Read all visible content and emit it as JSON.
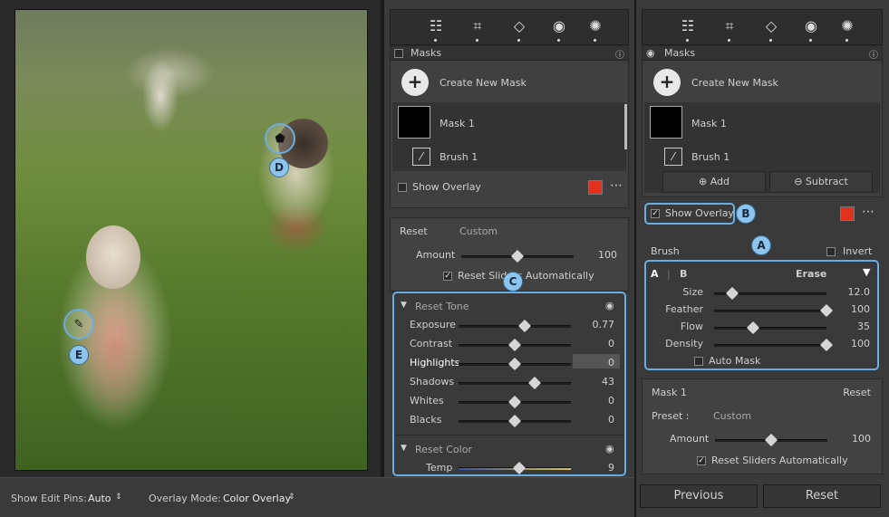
{
  "bottom_bar": {
    "edit_pins_label": "Show Edit Pins:",
    "edit_pins_value": "Auto",
    "overlay_mode_label": "Overlay Mode:",
    "overlay_mode_value": "Color Overlay"
  },
  "photo_markers": {
    "d": "D",
    "e": "E"
  },
  "left_panel": {
    "masks_title": "Masks",
    "create_mask": "Create New Mask",
    "mask_name": "Mask 1",
    "brush_name": "Brush 1",
    "show_overlay": "Show Overlay",
    "reset_label": "Reset",
    "preset_value": "Custom",
    "amount_label": "Amount",
    "amount_value": "100",
    "reset_sliders": "Reset Sliders Automatically",
    "badge_c": "C",
    "tone_title": "Reset Tone",
    "tone": [
      {
        "label": "Exposure",
        "value": "0.77",
        "pos": 0.59
      },
      {
        "label": "Contrast",
        "value": "0",
        "pos": 0.5
      },
      {
        "label": "Highlights",
        "value": "0",
        "pos": 0.5
      },
      {
        "label": "Shadows",
        "value": "43",
        "pos": 0.68
      },
      {
        "label": "Whites",
        "value": "0",
        "pos": 0.5
      },
      {
        "label": "Blacks",
        "value": "0",
        "pos": 0.5
      }
    ],
    "color_title": "Reset Color",
    "temp_label": "Temp",
    "temp_value": "9",
    "temp_pos": 0.54,
    "amount_pos": 0.5
  },
  "right_panel": {
    "masks_title": "Masks",
    "create_mask": "Create New Mask",
    "mask_name": "Mask 1",
    "brush_name": "Brush 1",
    "add": "Add",
    "subtract": "Subtract",
    "show_overlay": "Show Overlay",
    "badge_b": "B",
    "badge_a": "A",
    "brush_title": "Brush",
    "invert": "Invert",
    "tab_a": "A",
    "tab_b": "B",
    "tab_erase": "Erase",
    "brush": [
      {
        "label": "Size",
        "value": "12.0",
        "pos": 0.16
      },
      {
        "label": "Feather",
        "value": "100",
        "pos": 1.0
      },
      {
        "label": "Flow",
        "value": "35",
        "pos": 0.35
      },
      {
        "label": "Density",
        "value": "100",
        "pos": 1.0
      }
    ],
    "auto_mask": "Auto Mask",
    "mask_section": "Mask 1",
    "reset": "Reset",
    "preset_label": "Preset :",
    "preset_value": "Custom",
    "amount_label": "Amount",
    "amount_value": "100",
    "amount_pos": 0.5,
    "reset_sliders": "Reset Sliders Automatically",
    "previous": "Previous",
    "reset_button": "Reset"
  },
  "colors": {
    "accent": "#6aaee0",
    "overlay": "#e0301e"
  }
}
